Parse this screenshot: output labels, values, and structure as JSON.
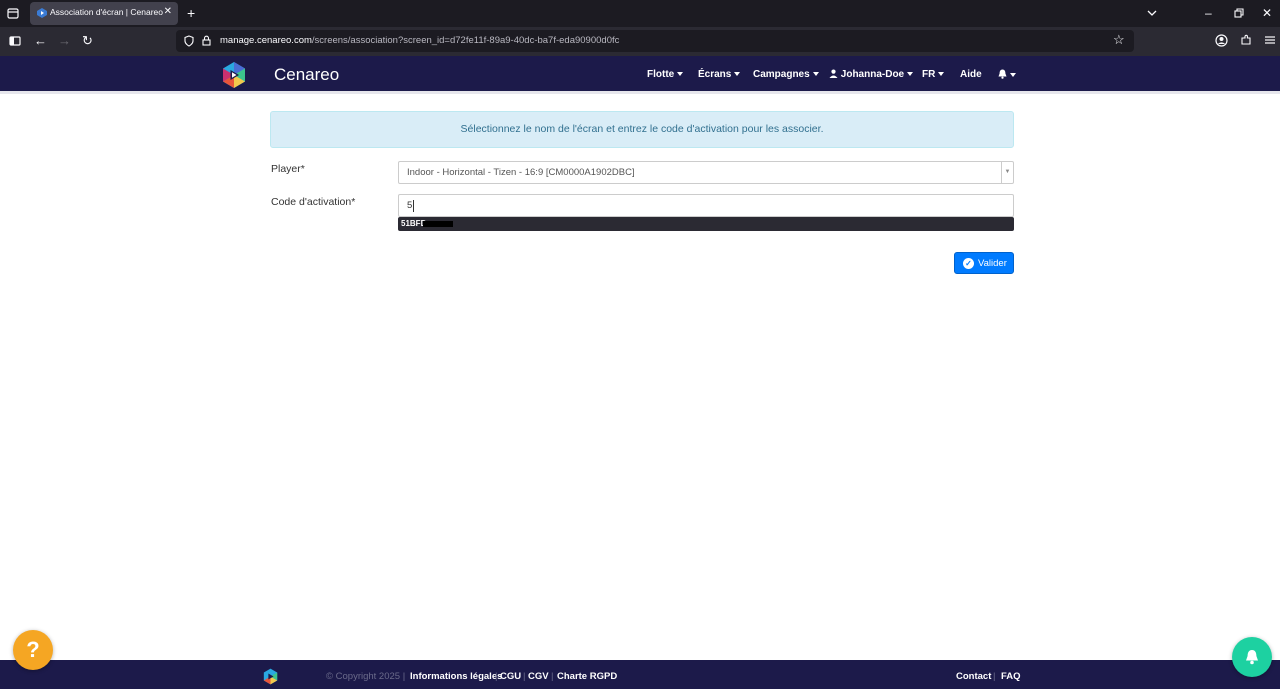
{
  "browser": {
    "tab_title": "Association d'écran | Cenareo",
    "url_host": "manage.cenareo.com",
    "url_prefix": "",
    "url_path": "/screens/association?screen_id=d72fe11f-89a9-40dc-ba7f-eda90900d0fc"
  },
  "header": {
    "brand": "Cenareo",
    "nav": {
      "flotte": "Flotte",
      "ecrans": "Écrans",
      "campagnes": "Campagnes",
      "user": "Johanna-Doe",
      "lang": "FR",
      "aide": "Aide"
    }
  },
  "main": {
    "alert": "Sélectionnez le nom de l'écran et entrez le code d'activation pour les associer.",
    "player_label": "Player*",
    "player_value": "Indoor - Horizontal - Tizen - 16:9 [CM0000A1902DBC]",
    "code_label": "Code d'activation*",
    "code_value": "5",
    "autocomplete_suggestion": "51BFD",
    "submit_label": "Valider"
  },
  "footer": {
    "copyright": "© Copyright 2025 |",
    "links": {
      "legal": "Informations légales",
      "cgu": "CGU",
      "cgv": "CGV",
      "rgpd": "Charte RGPD",
      "contact": "Contact",
      "faq": "FAQ"
    }
  },
  "help_fab": "?",
  "colors": {
    "header_bg": "#1c1a4a",
    "accent": "#007bff",
    "alert_bg": "#d9edf7",
    "help": "#f5a623",
    "notification": "#1dd1a1"
  }
}
